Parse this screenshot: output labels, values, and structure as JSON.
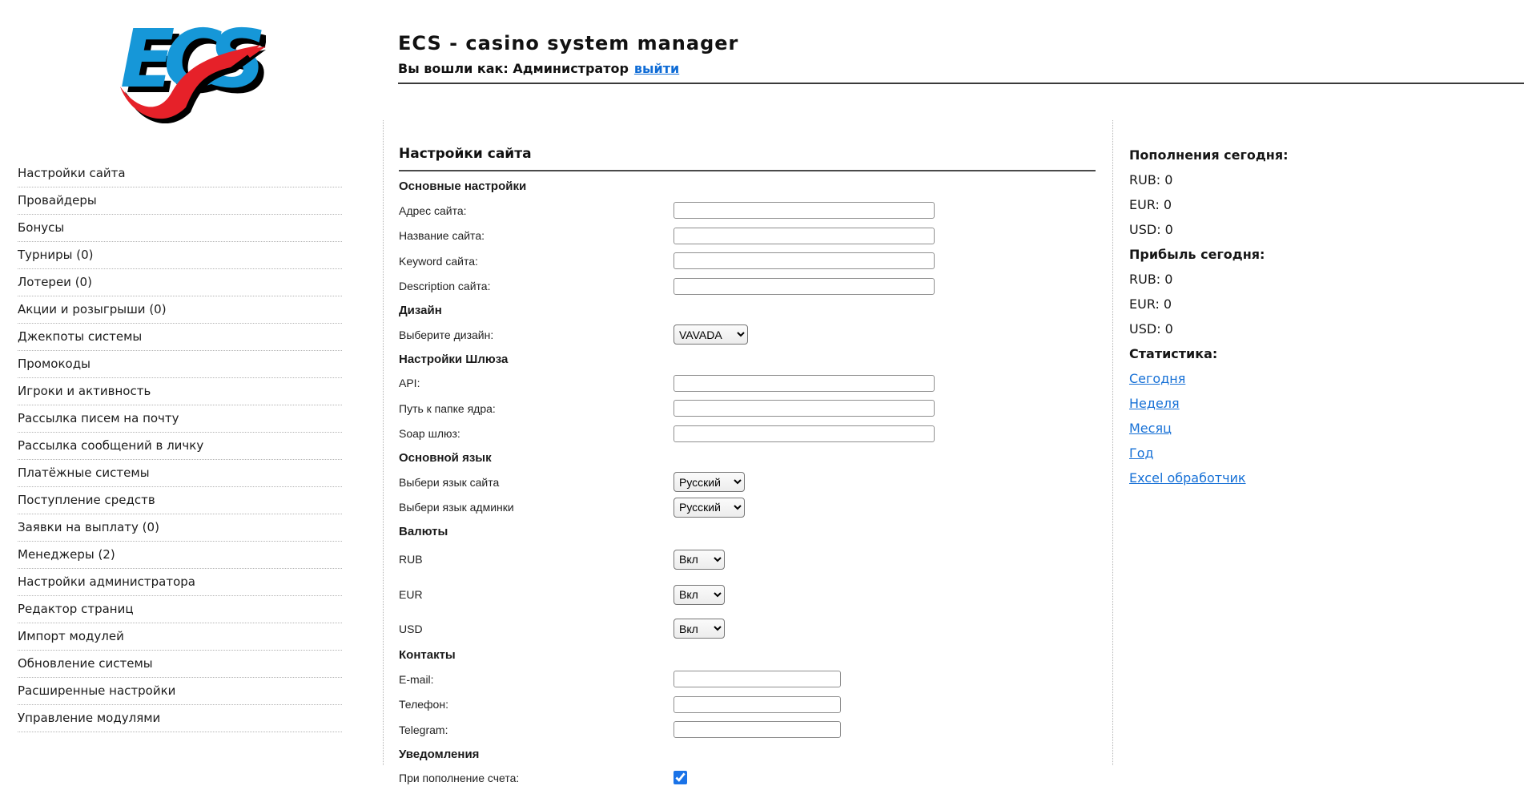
{
  "header": {
    "logo_text": "ECS",
    "title": "ECS - casino system manager",
    "login_prefix": "Вы вошли как: Администратор",
    "logout_label": "выйти"
  },
  "sidebar": {
    "items": [
      {
        "label": "Настройки сайта"
      },
      {
        "label": "Провайдеры"
      },
      {
        "label": "Бонусы"
      },
      {
        "label": "Турниры (0)"
      },
      {
        "label": "Лотереи (0)"
      },
      {
        "label": "Акции и розыгрыши (0)"
      },
      {
        "label": "Джекпоты системы"
      },
      {
        "label": "Промокоды"
      },
      {
        "label": "Игроки и активность"
      },
      {
        "label": "Рассылка писем на почту"
      },
      {
        "label": "Рассылка сообщений в личку"
      },
      {
        "label": "Платёжные системы"
      },
      {
        "label": "Поступление средств"
      },
      {
        "label": "Заявки на выплату (0)"
      },
      {
        "label": "Менеджеры (2)"
      },
      {
        "label": "Настройки администратора"
      },
      {
        "label": "Редактор страниц"
      },
      {
        "label": "Импорт модулей"
      },
      {
        "label": "Обновление системы"
      },
      {
        "label": "Расширенные настройки"
      },
      {
        "label": "Управление модулями"
      }
    ]
  },
  "main": {
    "title": "Настройки сайта",
    "sections": [
      {
        "id": "general",
        "header": "Основные настройки",
        "rows": [
          {
            "name": "site-address-field",
            "label": "Адрес сайта:",
            "control": "text",
            "value": "",
            "placeholder": ""
          },
          {
            "name": "site-name-field",
            "label": "Название сайта:",
            "control": "text",
            "value": "",
            "placeholder": ""
          },
          {
            "name": "site-keyword-field",
            "label": "Keyword сайта:",
            "control": "text",
            "value": "",
            "placeholder": ""
          },
          {
            "name": "site-description-field",
            "label": "Description сайта:",
            "control": "text",
            "value": "",
            "placeholder": ""
          }
        ]
      },
      {
        "id": "design",
        "header": "Дизайн",
        "rows": [
          {
            "name": "design-select",
            "label": "Выберите дизайн:",
            "control": "select",
            "value": "VAVADA"
          }
        ]
      },
      {
        "id": "gateway",
        "header": "Настройки Шлюза",
        "rows": [
          {
            "name": "api-field",
            "label": "API:",
            "control": "text",
            "value": "",
            "placeholder": ""
          },
          {
            "name": "core-path-field",
            "label": "Путь к папке ядра:",
            "control": "text",
            "value": "",
            "placeholder": ""
          },
          {
            "name": "soap-gateway-field",
            "label": "Soap шлюз:",
            "control": "text",
            "value": "",
            "placeholder": ""
          }
        ]
      },
      {
        "id": "language",
        "header": "Основной язык",
        "rows": [
          {
            "name": "site-language-select",
            "label": "Выбери язык сайта",
            "control": "select",
            "value": "Русский"
          },
          {
            "name": "admin-language-select",
            "label": "Выбери язык админки",
            "control": "select",
            "value": "Русский"
          }
        ]
      },
      {
        "id": "currencies",
        "header": "Валюты",
        "rows": [
          {
            "name": "rub-toggle-select",
            "label": "RUB",
            "control": "select",
            "value": "Вкл"
          },
          {
            "name": "eur-toggle-select",
            "label": "EUR",
            "control": "select",
            "value": "Вкл"
          },
          {
            "name": "usd-toggle-select",
            "label": "USD",
            "control": "select",
            "value": "Вкл"
          }
        ]
      },
      {
        "id": "contacts",
        "header": "Контакты",
        "rows": [
          {
            "name": "email-field",
            "label": "E-mail:",
            "control": "text",
            "value": "",
            "placeholder": ""
          },
          {
            "name": "phone-field",
            "label": "Телефон:",
            "control": "text",
            "value": "",
            "placeholder": ""
          },
          {
            "name": "telegram-field",
            "label": "Telegram:",
            "control": "text",
            "value": "",
            "placeholder": ""
          }
        ]
      },
      {
        "id": "notifications",
        "header": "Уведомления",
        "rows": [
          {
            "name": "deposit-notify-checkbox",
            "label": "При пополнение счета:",
            "control": "checkbox",
            "checked": true
          }
        ]
      }
    ]
  },
  "stats": {
    "groups": [
      {
        "header": "Пополнения сегодня:",
        "lines": [
          "RUB: 0",
          "EUR: 0",
          "USD: 0"
        ]
      },
      {
        "header": "Прибыль сегодня:",
        "lines": [
          "RUB: 0",
          "EUR: 0",
          "USD: 0"
        ]
      },
      {
        "header": "Статистика:",
        "links": [
          "Сегодня",
          "Неделя",
          "Месяц",
          "Год",
          "Excel обработчик"
        ]
      }
    ]
  },
  "colors": {
    "link_blue": "#1670d6",
    "logo_blue": "#1697d8",
    "logo_red": "#e62129",
    "checkbox_blue": "#1a73e8"
  }
}
